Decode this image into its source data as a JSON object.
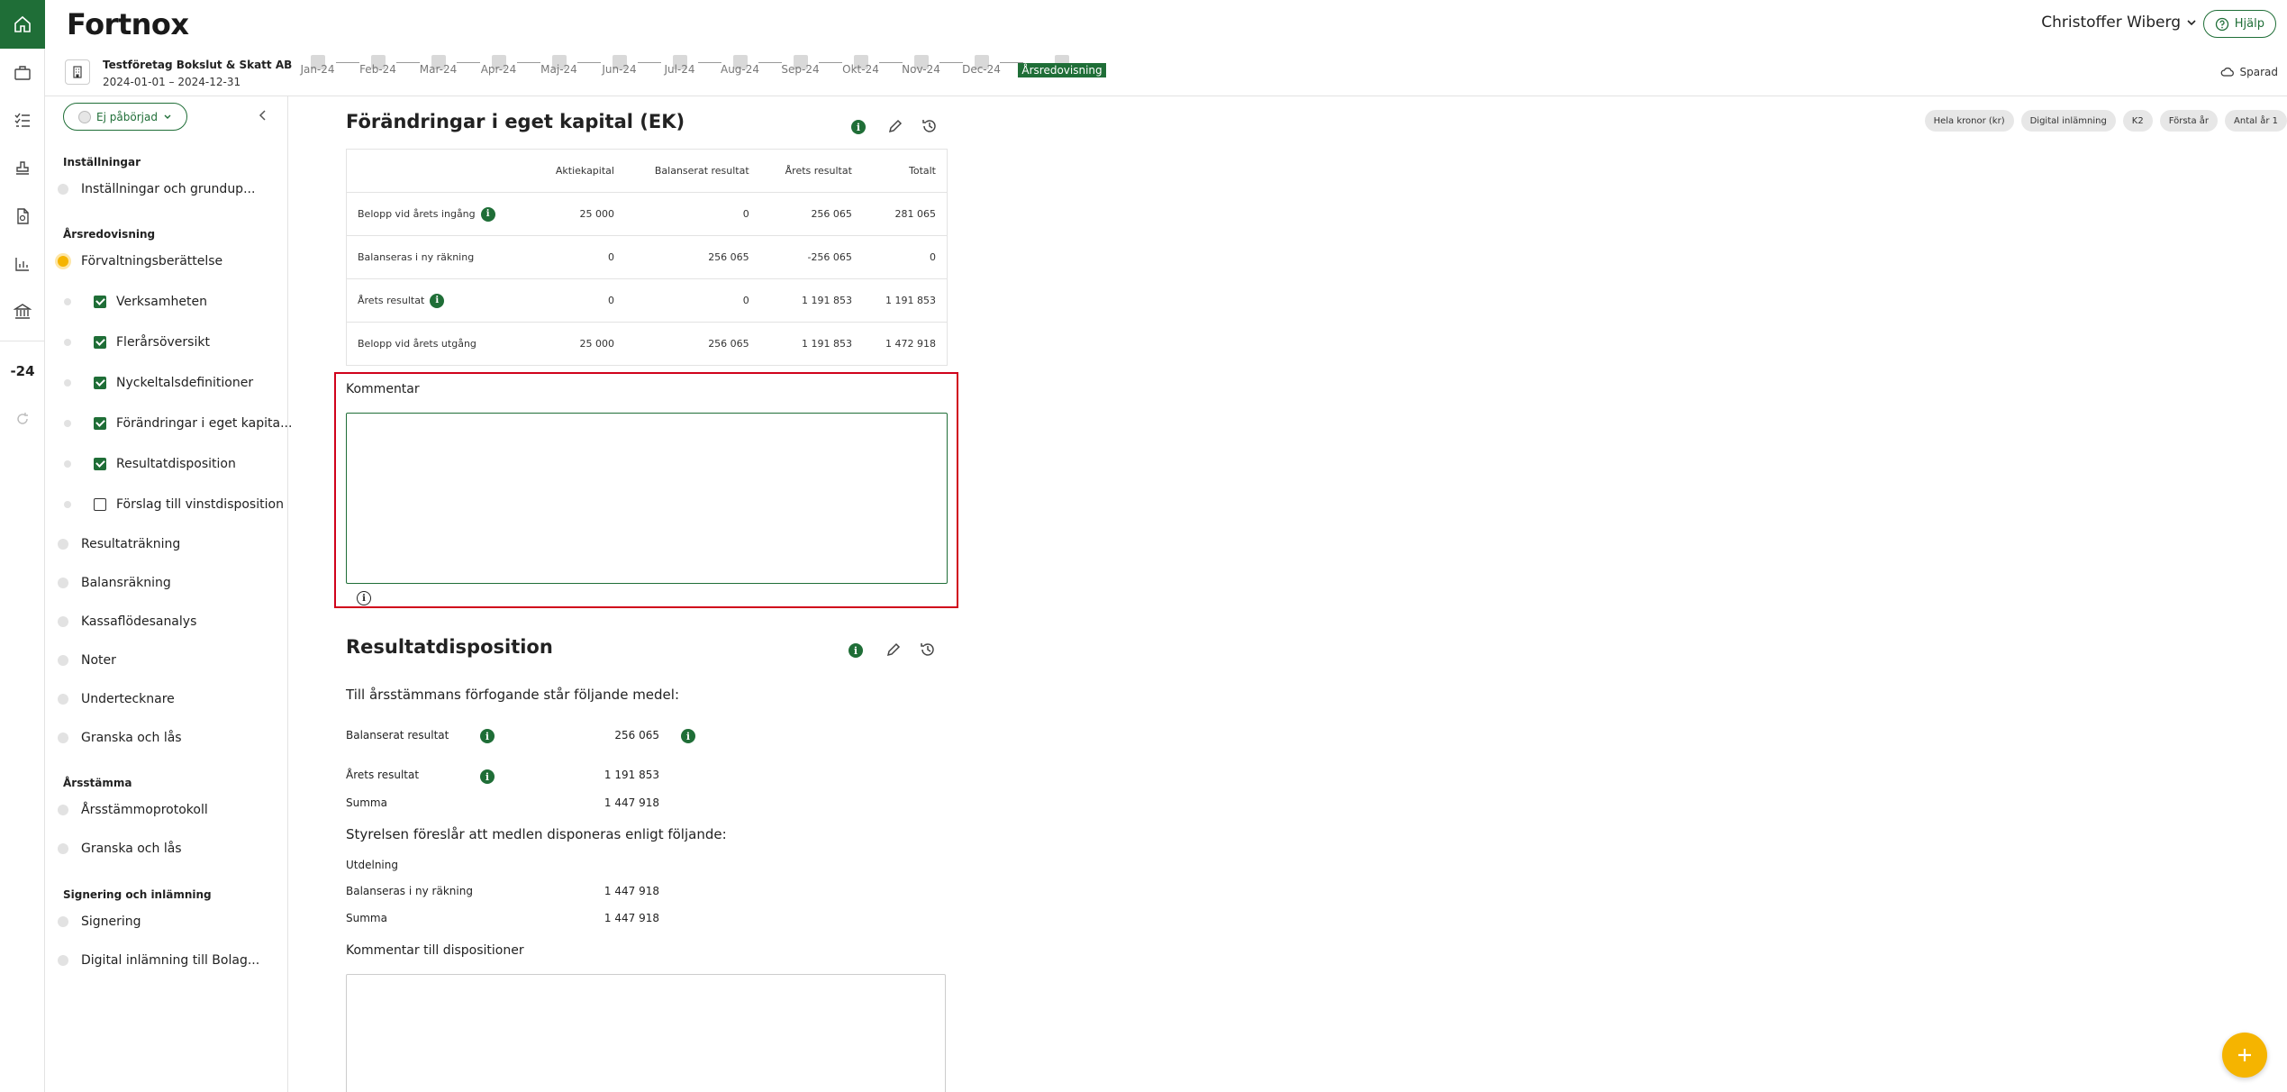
{
  "header": {
    "logo": "Fortnox",
    "user_name": "Christoffer Wiberg",
    "help_label": "Hjälp"
  },
  "company": {
    "name": "Testföretag Bokslut & Skatt AB",
    "period": "2024-01-01 – 2024-12-31"
  },
  "months": [
    "Jan-24",
    "Feb-24",
    "Mar-24",
    "Apr-24",
    "Maj-24",
    "Jun-24",
    "Jul-24",
    "Aug-24",
    "Sep-24",
    "Okt-24",
    "Nov-24",
    "Dec-24"
  ],
  "months_active": "Årsredovisning",
  "saved_label": "Sparad",
  "rail": {
    "year_label": "-24"
  },
  "sidebar": {
    "status": "Ej påbörjad",
    "sections": {
      "installningar": "Inställningar",
      "arsredovisning": "Årsredovisning",
      "arsstamma": "Årsstämma",
      "signering": "Signering och inlämning"
    },
    "items": {
      "installningar_grund": "Inställningar och grundup...",
      "forvaltning": "Förvaltningsberättelse",
      "verksamheten": "Verksamheten",
      "flerars": "Flerårsöversikt",
      "nyckeltal": "Nyckeltalsdefinitioner",
      "forandringar": "Förändringar i eget kapita...",
      "resultatdisposition": "Resultatdisposition",
      "forslag": "Förslag till vinstdisposition",
      "resultatrakning": "Resultaträkning",
      "balansrakning": "Balansräkning",
      "kassaflode": "Kassaflödesanalys",
      "noter": "Noter",
      "undertecknare": "Undertecknare",
      "granska1": "Granska och lås",
      "arsstammoprotokoll": "Årsstämmoprotokoll",
      "granska2": "Granska och lås",
      "signering": "Signering",
      "digital": "Digital inlämning till Bolag..."
    }
  },
  "tags": [
    "Hela kronor (kr)",
    "Digital inlämning",
    "K2",
    "Första år",
    "Antal år 1"
  ],
  "ek": {
    "title": "Förändringar i eget kapital (EK)",
    "columns": [
      "",
      "Aktiekapital",
      "Balanserat resultat",
      "Årets resultat",
      "Totalt"
    ],
    "rows": [
      [
        "Belopp vid årets ingång",
        "25 000",
        "0",
        "256 065",
        "281 065"
      ],
      [
        "Balanseras i ny räkning",
        "0",
        "256 065",
        "-256 065",
        "0"
      ],
      [
        "Årets resultat",
        "0",
        "0",
        "1 191 853",
        "1 191 853"
      ],
      [
        "Belopp vid årets utgång",
        "25 000",
        "256 065",
        "1 191 853",
        "1 472 918"
      ]
    ],
    "comment_label": "Kommentar",
    "comment_value": ""
  },
  "rd": {
    "title": "Resultatdisposition",
    "intro": "Till årsstämmans förfogande står följande medel:",
    "balanserat_label": "Balanserat resultat",
    "balanserat_value": "256 065",
    "arets_label": "Årets resultat",
    "arets_value": "1 191 853",
    "summa1_label": "Summa",
    "summa1_value": "1 447 918",
    "styrelsen": "Styrelsen föreslår att medlen disponeras enligt följande:",
    "utdelning_label": "Utdelning",
    "balanseras_label": "Balanseras i ny räkning",
    "balanseras_value": "1 447 918",
    "summa2_label": "Summa",
    "summa2_value": "1 447 918",
    "kommentar_label": "Kommentar till dispositioner"
  }
}
